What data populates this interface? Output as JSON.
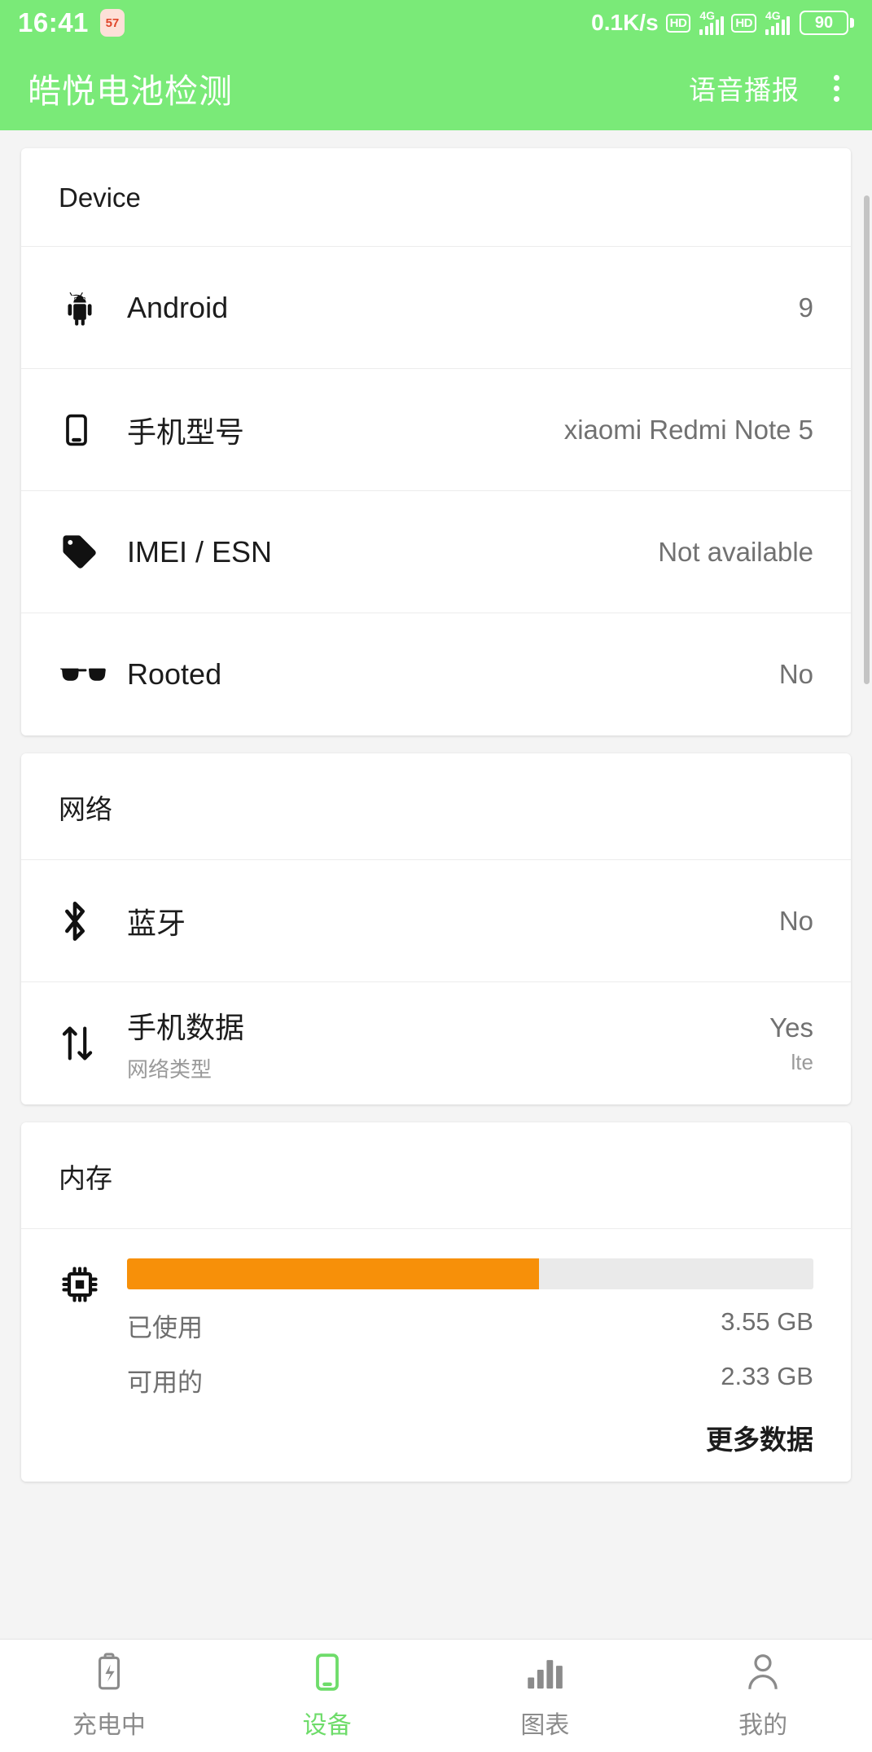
{
  "status_bar": {
    "time": "16:41",
    "app_badge": "57",
    "network_speed": "0.1K/s",
    "sim1_hd": "HD",
    "sim1_network": "4G",
    "sim2_hd": "HD",
    "sim2_network": "4G",
    "battery_level": "90"
  },
  "app_bar": {
    "title": "皓悦电池检测",
    "voice_broadcast": "语音播报",
    "overflow_icon": "more-vertical-icon"
  },
  "cards": [
    {
      "title": "Device",
      "rows": [
        {
          "icon": "android-icon",
          "label": "Android",
          "value": "9"
        },
        {
          "icon": "phone-icon",
          "label": "手机型号",
          "value": "xiaomi Redmi Note 5"
        },
        {
          "icon": "tag-icon",
          "label": "IMEI / ESN",
          "value": "Not available"
        },
        {
          "icon": "sunglasses-icon",
          "label": "Rooted",
          "value": "No"
        }
      ]
    },
    {
      "title": "网络",
      "rows": [
        {
          "icon": "bluetooth-icon",
          "label": "蓝牙",
          "value": "No"
        },
        {
          "icon": "data-transfer-icon",
          "label": "手机数据",
          "sub_label": "网络类型",
          "value": "Yes",
          "sub_value": "lte"
        }
      ]
    }
  ],
  "memory": {
    "title": "内存",
    "icon": "cpu-chip-icon",
    "used_percent": 60,
    "used_label": "已使用",
    "used_value": "3.55 GB",
    "free_label": "可用的",
    "free_value": "2.33 GB",
    "more_data": "更多数据",
    "bar_color": "#f79009"
  },
  "bottom_nav": {
    "items": [
      {
        "icon": "battery-charging-icon",
        "label": "充电中",
        "active": false
      },
      {
        "icon": "phone-device-icon",
        "label": "设备",
        "active": true
      },
      {
        "icon": "bar-chart-icon",
        "label": "图表",
        "active": false
      },
      {
        "icon": "person-icon",
        "label": "我的",
        "active": false
      }
    ],
    "active_color": "#6edc6a",
    "inactive_color": "#8b8b8b"
  },
  "theme": {
    "primary": "#7aea78",
    "accent_orange": "#f79009"
  }
}
